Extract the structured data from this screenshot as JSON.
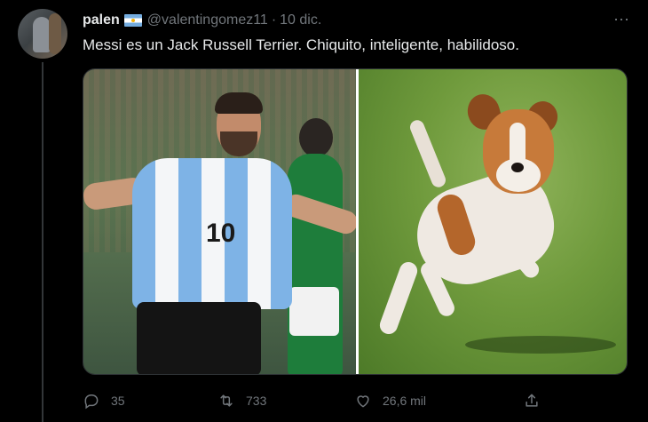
{
  "tweet": {
    "display_name": "palen",
    "handle": "@valentingomez11",
    "separator": "·",
    "date": "10 dic.",
    "more_icon": "⋯",
    "text": "Messi es un Jack Russell Terrier. Chiquito, inteligente, habilidoso.",
    "flag_icon": "argentina-flag-icon"
  },
  "media": {
    "left_number": "10"
  },
  "actions": {
    "reply_count": "35",
    "retweet_count": "733",
    "like_count": "26,6 mil"
  },
  "colors": {
    "background": "#000000",
    "text": "#e7e9ea",
    "muted": "#71767b"
  }
}
